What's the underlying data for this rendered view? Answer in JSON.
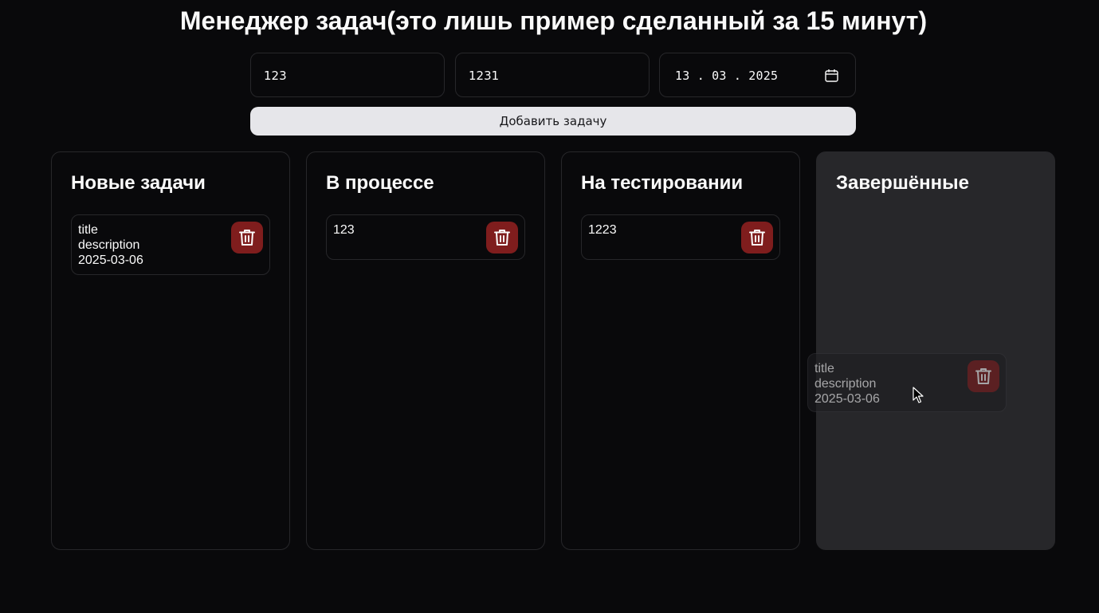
{
  "header": {
    "title": "Менеджер задач(это лишь пример сделанный за 15 минут)"
  },
  "form": {
    "title_value": "123",
    "description_value": "1231",
    "date_value": "13 . 03 . 2025",
    "add_button_label": "Добавить задачу"
  },
  "columns": [
    {
      "title": "Новые задачи",
      "tasks": [
        {
          "title": "title",
          "description": "description",
          "date": "2025-03-06"
        }
      ]
    },
    {
      "title": "В процессе",
      "tasks": [
        {
          "title": "123"
        }
      ]
    },
    {
      "title": "На тестировании",
      "tasks": [
        {
          "title": "1223"
        }
      ]
    },
    {
      "title": "Завершённые",
      "tasks": []
    }
  ],
  "drag_preview": {
    "title": "title",
    "description": "description",
    "date": "2025-03-06"
  },
  "icons": {
    "delete": "trash-icon",
    "date": "calendar-icon",
    "cursor": "mouse-pointer-icon"
  },
  "colors": {
    "background": "#09090b",
    "delete_button": "#7f1d1d",
    "add_button": "#e6e6ea",
    "highlight_column": "#27272a"
  }
}
